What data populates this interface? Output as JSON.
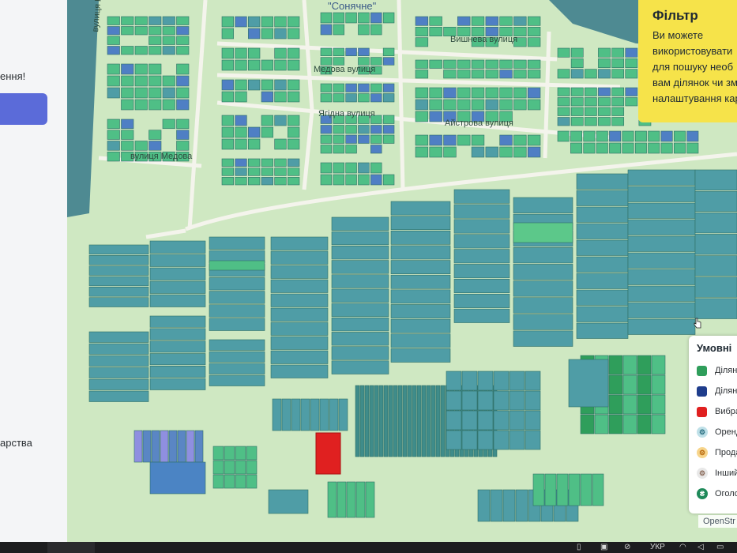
{
  "left_panel": {
    "text_top": "ення!",
    "text_bottom": "арства"
  },
  "map": {
    "village_label": "\"Сонячне\"",
    "streets": {
      "vyshneva": "Вишнева вулиця",
      "medova": "Медова вулиця",
      "yahidna": "Ягідна вулиця",
      "aistrova": "Айстрова вулиця",
      "medova_west": "вулиця Медова",
      "kvitkova": "вулиця Квіт"
    }
  },
  "filter": {
    "title": "Фільтр",
    "line1": "Ви можете",
    "line2": "використовувати",
    "line3": "для пошуку необ",
    "line4": "вам ділянок чи зм",
    "line5": "налаштування кар"
  },
  "legend": {
    "title": "Умовні",
    "items": [
      {
        "label": "Ділян",
        "color": "#2f9e5b"
      },
      {
        "label": "Ділян",
        "color": "#1f3d8c"
      },
      {
        "label": "Вибра",
        "color": "#e02020"
      },
      {
        "label": "Оренд",
        "icon": "lease-icon"
      },
      {
        "label": "Продаж",
        "icon": "sale-icon"
      },
      {
        "label": "Інший т",
        "icon": "other-icon"
      },
      {
        "label": "Оголош",
        "icon": "announcement-icon"
      }
    ]
  },
  "attribution": "OpenStr",
  "taskbar": {
    "language": "УКР"
  },
  "colors": {
    "parcel_green": "#4fbf86",
    "parcel_teal": "#4f9da6",
    "parcel_blue": "#4f7fc4",
    "selected": "#e02020",
    "filter_bg": "#f6e34a",
    "map_bg": "#cfe8c2"
  }
}
